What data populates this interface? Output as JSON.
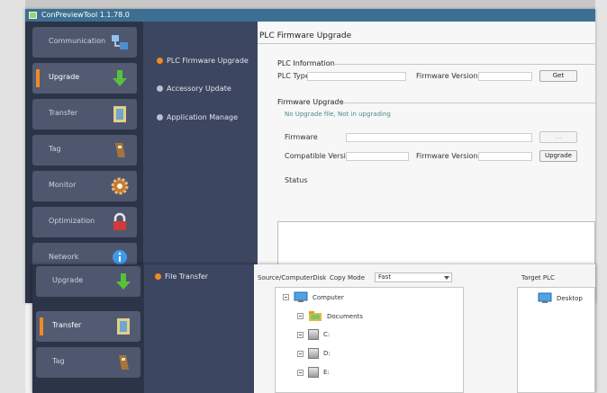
{
  "window1": {
    "title": "ConPreviewTool 1.1.78.0",
    "nav": [
      {
        "label": "Communication",
        "icon": "network-icon",
        "active": false
      },
      {
        "label": "Upgrade",
        "icon": "download-arrow-icon",
        "active": true
      },
      {
        "label": "Transfer",
        "icon": "document-icon",
        "active": false
      },
      {
        "label": "Tag",
        "icon": "tag-icon",
        "active": false
      },
      {
        "label": "Monitor",
        "icon": "gear-icon",
        "active": false
      },
      {
        "label": "Optimization",
        "icon": "lock-icon",
        "active": false
      },
      {
        "label": "Network",
        "icon": "info-icon",
        "active": false
      }
    ],
    "subnav": [
      {
        "label": "PLC Firmware Upgrade",
        "active": true
      },
      {
        "label": "Accessory Update",
        "active": false
      },
      {
        "label": "Application Manage",
        "active": false
      }
    ],
    "panel": {
      "title": "PLC Firmware Upgrade",
      "plc_info_title": "PLC Information",
      "plc_type_label": "PLC Type",
      "firmware_version_label": "Firmware Version",
      "get_button": "Get",
      "upgrade_title": "Firmware Upgrade",
      "hint": "No Upgrade file, Not in upgrading",
      "firmware_label": "Firmware",
      "compatible_version_label": "Compatible Version",
      "firmware_version_label2": "Firmware Version",
      "browse_button": "...",
      "upgrade_button": "Upgrade",
      "status_label": "Status"
    }
  },
  "window2": {
    "nav": [
      {
        "label": "Upgrade",
        "icon": "download-arrow-icon",
        "active": false
      },
      {
        "label": "Transfer",
        "icon": "document-icon",
        "active": true
      },
      {
        "label": "Tag",
        "icon": "tag-icon",
        "active": false
      }
    ],
    "subnav": [
      {
        "label": "File Transfer",
        "active": true
      }
    ],
    "panel": {
      "source_label": "Source/ComputerDisk",
      "copy_mode_label": "Copy Mode",
      "copy_mode_value": "Fast",
      "target_label": "Target PLC",
      "tree": [
        {
          "label": "Computer",
          "level": 0,
          "icon": "computer-icon"
        },
        {
          "label": "Documents",
          "level": 1,
          "icon": "folder-icon"
        },
        {
          "label": "C:",
          "level": 1,
          "icon": "drive-icon"
        },
        {
          "label": "D:",
          "level": 1,
          "icon": "drive-icon"
        },
        {
          "label": "E:",
          "level": 1,
          "icon": "drive-icon"
        }
      ],
      "target_tree": [
        {
          "label": "Desktop",
          "icon": "computer-icon"
        }
      ]
    }
  },
  "colors": {
    "sidebar": "#2c3447",
    "subnav": "#3d4660",
    "accent": "#f08a22",
    "titlebar": "#3d6f92"
  }
}
